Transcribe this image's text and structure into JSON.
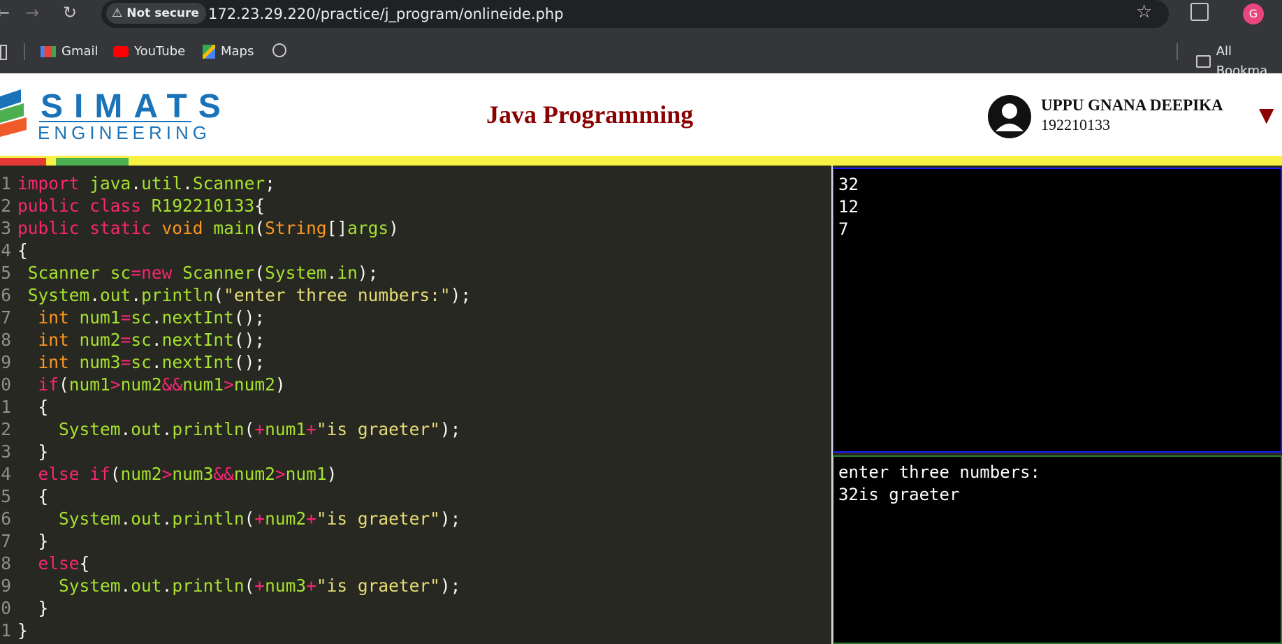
{
  "browser": {
    "security_label": "Not secure",
    "url": "172.23.29.220/practice/j_program/onlineide.php",
    "profile_initial": "G",
    "bookmarks": [
      {
        "label": "Gmail"
      },
      {
        "label": "YouTube"
      },
      {
        "label": "Maps"
      }
    ],
    "all_bookmarks_label": "All Bookma"
  },
  "header": {
    "logo_top": "SIMATS",
    "logo_bottom": "ENGINEERING",
    "title": "Java Programming",
    "user_name": "UPPU GNANA DEEPIKA",
    "user_id": "192210133"
  },
  "editor": {
    "line_numbers": [
      "1",
      "2",
      "3",
      "4",
      "5",
      "6",
      "7",
      "8",
      "9",
      "0",
      "1",
      "2",
      "3",
      "4",
      "5",
      "6",
      "7",
      "8",
      "9",
      "0",
      "1"
    ]
  },
  "input_console": {
    "lines": [
      "32",
      "12",
      "7"
    ]
  },
  "output_console": {
    "lines": [
      "enter three numbers:",
      "32is graeter"
    ]
  },
  "colors": {
    "editor_bg": "#272822",
    "title_color": "#8b0000",
    "logo_color": "#1a73b8",
    "stripe_yellow": "#f7f143",
    "stripe_red": "#e53935",
    "stripe_green": "#4caf50",
    "input_border": "#1a1aff",
    "output_border": "#2e7d32"
  }
}
